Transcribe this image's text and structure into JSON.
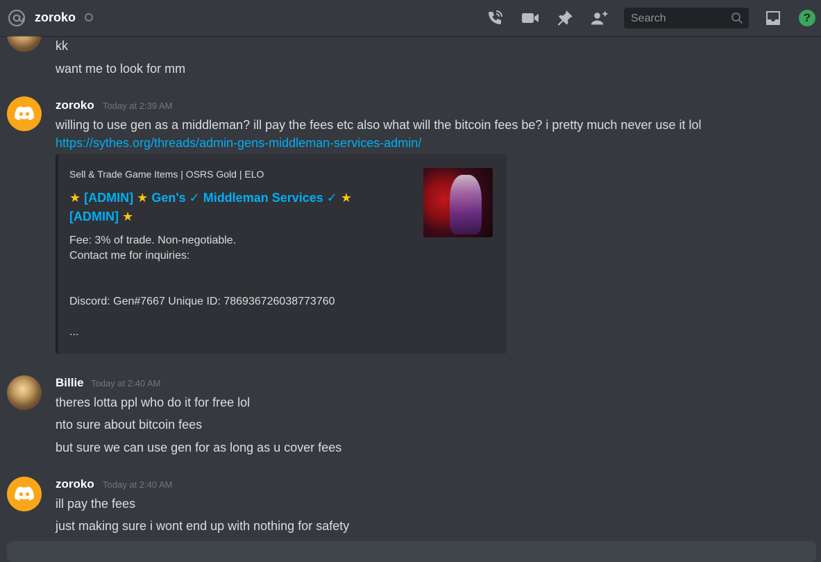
{
  "header": {
    "title": "zoroko",
    "search_placeholder": "Search",
    "icons": [
      "at-icon",
      "start-voice-call-icon",
      "start-video-call-icon",
      "pinned-messages-icon",
      "add-friends-to-dm-icon",
      "search-icon",
      "inbox-icon",
      "help-icon"
    ],
    "help_glyph": "?"
  },
  "messages": {
    "continued": {
      "lines": [
        "kk",
        "want me to look for mm"
      ]
    },
    "group1": {
      "username": "zoroko",
      "timestamp": "Today at 2:39 AM",
      "text": "willing to use gen as a middleman? ill pay the fees etc also what will the bitcoin fees be? i pretty much never use it lol",
      "link": "https://sythes.org/threads/admin-gens-middleman-services-admin/",
      "embed": {
        "provider": "Sell & Trade Game Items | OSRS Gold | ELO",
        "title_line1": "[ADMIN]",
        "title_line1b": "Gen's ✓ Middleman Services ✓",
        "title_line2": "[ADMIN]",
        "star": "★",
        "desc_line1": "Fee: 3% of trade. Non-negotiable.",
        "desc_line2": "Contact me for inquiries:",
        "desc_line3": "Discord: Gen#7667 Unique ID: 786936726038773760",
        "desc_line4": "..."
      }
    },
    "group2": {
      "username": "Billie",
      "timestamp": "Today at 2:40 AM",
      "lines": [
        "theres lotta ppl who do it for free lol",
        "nto sure about bitcoin fees",
        "but sure we can use gen for as long as u cover fees"
      ]
    },
    "group3": {
      "username": "zoroko",
      "timestamp": "Today at 2:40 AM",
      "lines": [
        "ill pay the fees",
        "just making sure i wont end up with nothing for safety"
      ]
    }
  },
  "colors": {
    "background": "#36393f",
    "link": "#00aff4",
    "discord_avatar": "#faa61a",
    "online_help": "#3ba55c"
  }
}
